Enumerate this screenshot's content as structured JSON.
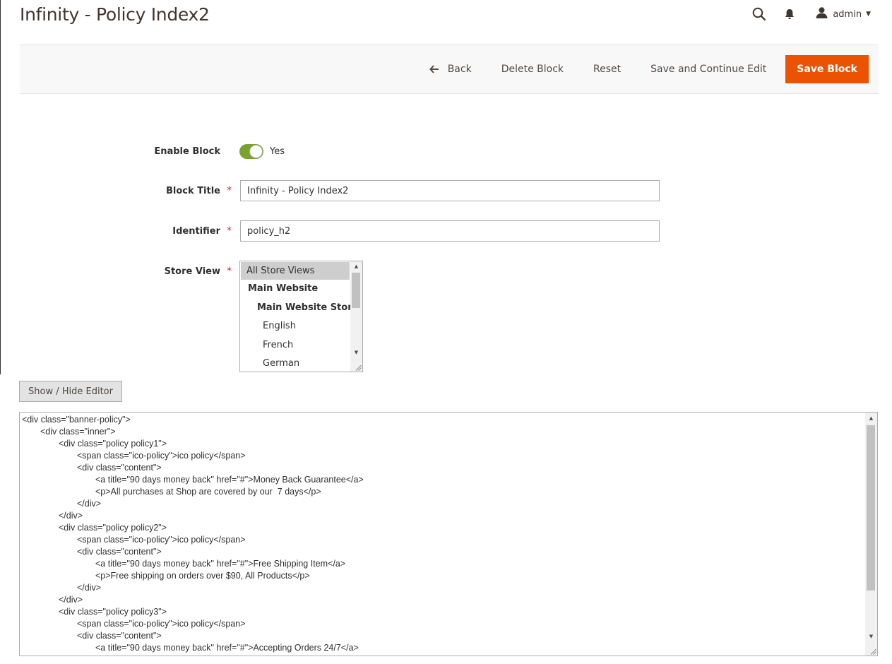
{
  "page": {
    "title": "Infinity - Policy Index2"
  },
  "header": {
    "user_name": "admin",
    "icons": [
      "search-icon",
      "bell-icon",
      "user-icon",
      "caret-down-icon"
    ]
  },
  "actions": {
    "back": "Back",
    "delete": "Delete Block",
    "reset": "Reset",
    "save_continue": "Save and Continue Edit",
    "save": "Save Block"
  },
  "form": {
    "enable": {
      "label": "Enable Block",
      "value": "Yes",
      "on": true
    },
    "title": {
      "label": "Block Title",
      "value": "Infinity - Policy Index2"
    },
    "identifier": {
      "label": "Identifier",
      "value": "policy_h2"
    },
    "store_view": {
      "label": "Store View",
      "options": [
        "All Store Views",
        "Main Website",
        "Main Website Store",
        "English",
        "French",
        "German"
      ],
      "selected": "All Store Views"
    }
  },
  "editor": {
    "toggle_label": "Show / Hide Editor",
    "content": "<div class=\"banner-policy\">\n\t<div class=\"inner\">\n\t\t<div class=\"policy policy1\">\n\t\t\t<span class=\"ico-policy\">ico policy</span>\n\t\t\t<div class=\"content\">\n\t\t\t\t<a title=\"90 days money back\" href=\"#\">Money Back Guarantee</a>\n\t\t\t\t<p>All purchases at Shop are covered by our  7 days</p>\n\t\t\t</div>\n\t\t</div>\n\t\t<div class=\"policy policy2\">\n\t\t\t<span class=\"ico-policy\">ico policy</span>\n\t\t\t<div class=\"content\">\n\t\t\t\t<a title=\"90 days money back\" href=\"#\">Free Shipping Item</a>\n\t\t\t\t<p>Free shipping on orders over $90, All Products</p>\n\t\t\t</div>\n\t\t</div>\n\t\t<div class=\"policy policy3\">\n\t\t\t<span class=\"ico-policy\">ico policy</span>\n\t\t\t<div class=\"content\">\n\t\t\t\t<a title=\"90 days money back\" href=\"#\">Accepting Orders 24/7</a>"
  },
  "colors": {
    "primary": "#eb5202",
    "toggle_on": "#79a22e",
    "required": "#e22626"
  }
}
